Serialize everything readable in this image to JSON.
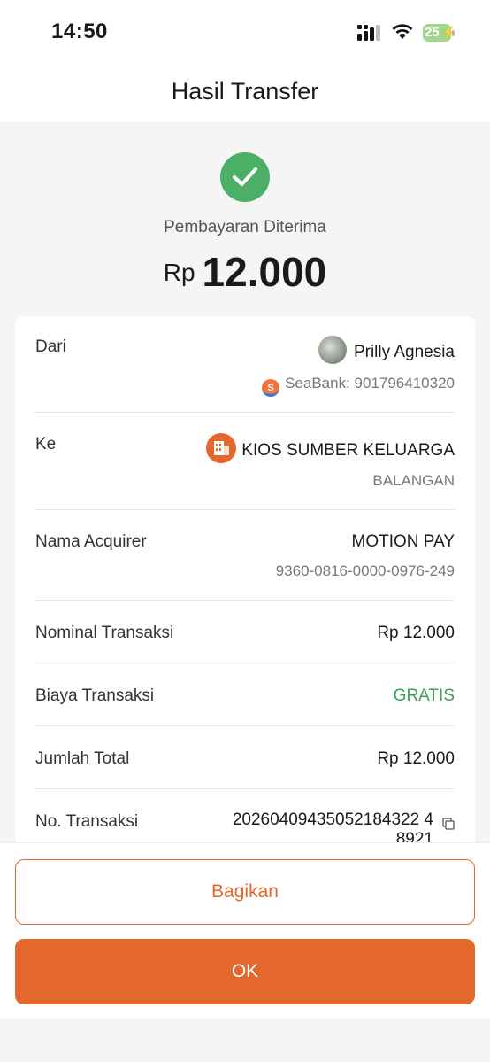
{
  "status_bar": {
    "time": "14:50",
    "battery": "25"
  },
  "header": {
    "title": "Hasil Transfer"
  },
  "result": {
    "status": "Pembayaran Diterima",
    "currency": "Rp",
    "amount": "12.000"
  },
  "details": {
    "from": {
      "label": "Dari",
      "name": "Prilly Agnesia",
      "bank": "SeaBank: 901796410320"
    },
    "to": {
      "label": "Ke",
      "name": "KIOS SUMBER KELUARGA",
      "location": "BALANGAN"
    },
    "acquirer": {
      "label": "Nama Acquirer",
      "name": "MOTION PAY",
      "id": "9360-0816-0000-0976-249"
    },
    "nominal": {
      "label": "Nominal Transaksi",
      "value": "Rp 12.000"
    },
    "fee": {
      "label": "Biaya Transaksi",
      "value": "GRATIS"
    },
    "total": {
      "label": "Jumlah Total",
      "value": "Rp 12.000"
    },
    "transaction_no": {
      "label": "No. Transaksi",
      "line1": "20260409435052184322 4",
      "line2": "8921"
    }
  },
  "actions": {
    "share": "Bagikan",
    "ok": "OK"
  },
  "colors": {
    "accent": "#e4672c",
    "success": "#4caf66",
    "free": "#3c9e57"
  }
}
